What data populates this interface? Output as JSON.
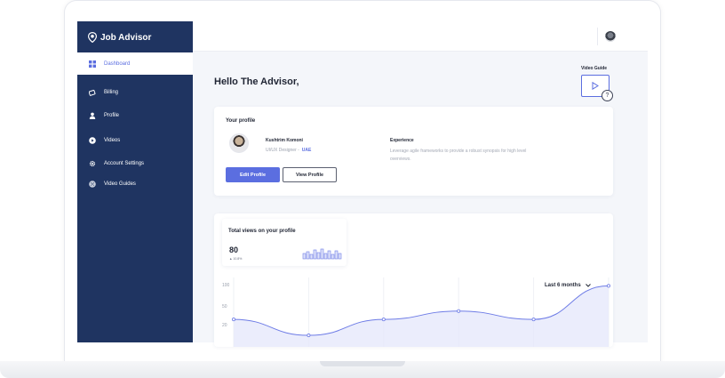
{
  "app": {
    "brand_name": "Job Advisor"
  },
  "sidebar": {
    "items": [
      {
        "label": "Dashboard",
        "icon": "grid-icon",
        "active": true
      },
      {
        "label": "Billing",
        "icon": "card-icon",
        "active": false
      },
      {
        "label": "Profile",
        "icon": "user-icon",
        "active": false
      },
      {
        "label": "Videos",
        "icon": "play-icon",
        "active": false
      },
      {
        "label": "Account Settings",
        "icon": "gear-icon",
        "active": false
      },
      {
        "label": "Video Guides",
        "icon": "globe-icon",
        "active": false
      }
    ]
  },
  "header": {
    "greeting": "Hello The Advisor,",
    "video_guide_label": "Video Guide",
    "help_symbol": "?"
  },
  "profile": {
    "title": "Your profile",
    "name": "Kushtrim Komoni",
    "role": "UI/UX Designer -",
    "location": "UAE",
    "experience_title": "Experience",
    "experience_text": "Leverage agile frameworks to provide a robust synopsis for high level overviews.",
    "edit_button": "Edit Profile",
    "view_button": "View Profile"
  },
  "views": {
    "title": "Total views on your profile",
    "value": "80",
    "delta": "▲ 10.8%",
    "range_label": "Last 6 months",
    "range_chevron": "⌄"
  },
  "chart_data": {
    "type": "area",
    "x": [
      0,
      1,
      2,
      3,
      4,
      5
    ],
    "values": [
      20,
      1,
      20,
      30,
      20,
      60
    ],
    "y_ticks": [
      "100",
      "50",
      "20"
    ],
    "grid": true,
    "color": "#6e7ce6",
    "fill": "#e6e9fb"
  },
  "colors": {
    "sidebar": "#1f3461",
    "accent": "#5b6ee0"
  }
}
